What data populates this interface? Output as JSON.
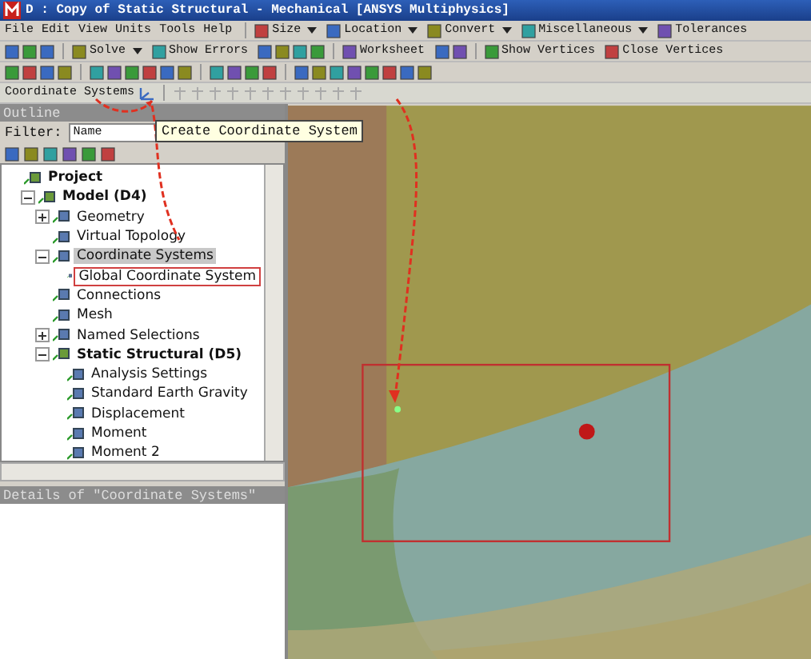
{
  "window": {
    "title": "D : Copy of Static Structural - Mechanical [ANSYS Multiphysics]"
  },
  "menu_bar": {
    "items": [
      "File",
      "Edit",
      "View",
      "Units",
      "Tools",
      "Help"
    ],
    "tools": [
      {
        "label": "Size",
        "dropdown": true
      },
      {
        "label": "Location",
        "dropdown": true
      },
      {
        "label": "Convert",
        "dropdown": true
      },
      {
        "label": "Miscellaneous",
        "dropdown": true
      },
      {
        "label": "Tolerances",
        "dropdown": false
      }
    ]
  },
  "toolbar": {
    "buttons": [
      {
        "label": "Solve",
        "dropdown": true
      },
      {
        "label": "Show Errors",
        "dropdown": false
      },
      {
        "label": "Worksheet",
        "dropdown": false
      },
      {
        "label": "Show Vertices",
        "dropdown": false
      },
      {
        "label": "Close Vertices",
        "dropdown": false
      }
    ]
  },
  "context_toolbar": {
    "label": "Coordinate Systems"
  },
  "tooltip": "Create Coordinate System",
  "outline": {
    "title": "Outline",
    "filter_label": "Filter:",
    "filter_value": "Name"
  },
  "tree": [
    {
      "label": "Project",
      "bold": true,
      "selected": false,
      "annotated": false,
      "children": [
        {
          "label": "Model (D4)",
          "expanded": true,
          "bold": true,
          "selected": false,
          "annotated": false,
          "children": [
            {
              "label": "Geometry",
              "expanded": false,
              "bold": false,
              "selected": false,
              "annotated": false
            },
            {
              "label": "Virtual Topology",
              "bold": false,
              "selected": false,
              "annotated": false
            },
            {
              "label": "Coordinate Systems",
              "expanded": true,
              "bold": false,
              "selected": true,
              "annotated": false,
              "children": [
                {
                  "label": "Global Coordinate System",
                  "bold": false,
                  "selected": false,
                  "annotated": true
                }
              ]
            },
            {
              "label": "Connections",
              "bold": false,
              "selected": false,
              "annotated": false
            },
            {
              "label": "Mesh",
              "bold": false,
              "selected": false,
              "annotated": false
            },
            {
              "label": "Named Selections",
              "expanded": false,
              "bold": false,
              "selected": false,
              "annotated": false
            },
            {
              "label": "Static Structural (D5)",
              "expanded": true,
              "bold": true,
              "selected": false,
              "annotated": false,
              "children": [
                {
                  "label": "Analysis Settings",
                  "bold": false,
                  "selected": false,
                  "annotated": false
                },
                {
                  "label": "Standard Earth Gravity",
                  "bold": false,
                  "selected": false,
                  "annotated": false
                },
                {
                  "label": "Displacement",
                  "bold": false,
                  "selected": false,
                  "annotated": false
                },
                {
                  "label": "Moment",
                  "bold": false,
                  "selected": false,
                  "annotated": false
                },
                {
                  "label": "Moment 2",
                  "bold": false,
                  "selected": false,
                  "annotated": false
                }
              ]
            }
          ]
        }
      ]
    }
  ],
  "details": {
    "title": "Details of \"Coordinate Systems\""
  }
}
